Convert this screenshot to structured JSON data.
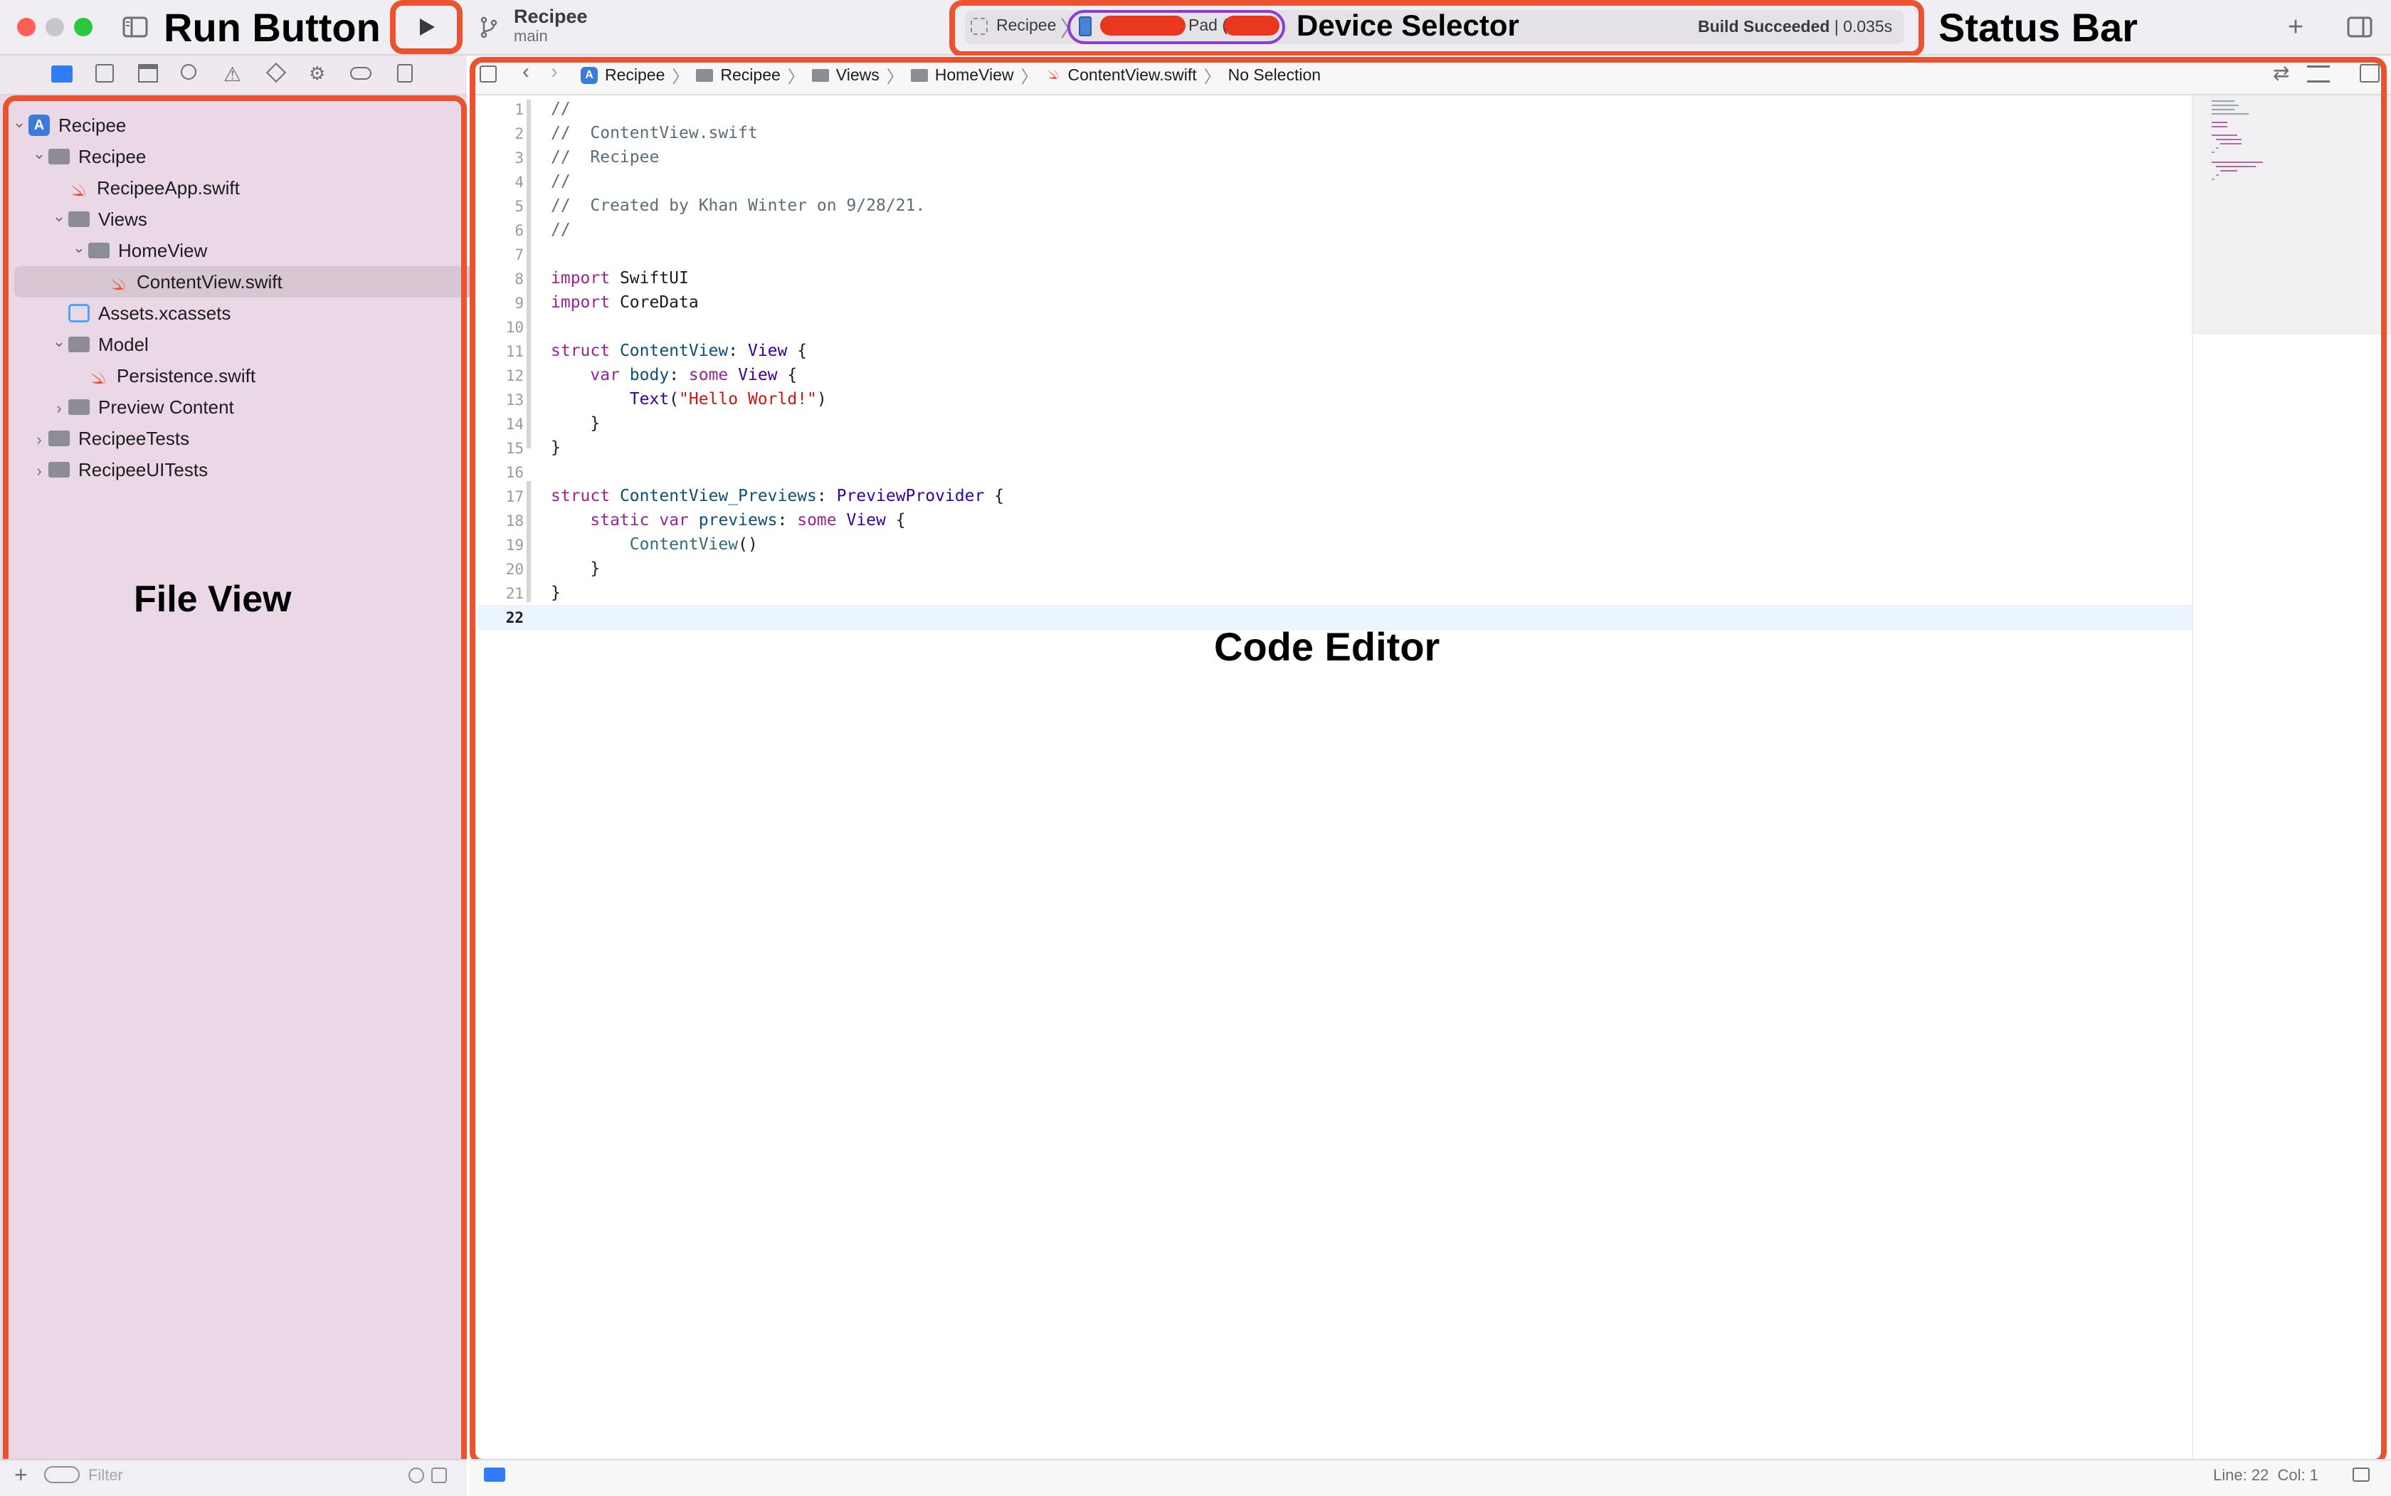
{
  "toolbar": {
    "project": "Recipee",
    "branch": "main",
    "scheme": "Recipee",
    "device_suffix": "Pad (",
    "build_status_bold": "Build Succeeded",
    "build_status_rest": "| 0.035s"
  },
  "annotations": {
    "run_button": "Run Button",
    "device_selector": "Device Selector",
    "status_bar": "Status Bar",
    "file_view": "File View",
    "code_editor": "Code Editor"
  },
  "navigator": {
    "items": [
      {
        "label": "Recipee",
        "kind": "project",
        "depth": 0,
        "disclosure": "open"
      },
      {
        "label": "Recipee",
        "kind": "folder",
        "depth": 1,
        "disclosure": "open"
      },
      {
        "label": "RecipeeApp.swift",
        "kind": "swift",
        "depth": 2,
        "disclosure": "none"
      },
      {
        "label": "Views",
        "kind": "folder",
        "depth": 2,
        "disclosure": "open"
      },
      {
        "label": "HomeView",
        "kind": "folder",
        "depth": 3,
        "disclosure": "open"
      },
      {
        "label": "ContentView.swift",
        "kind": "swift",
        "depth": 4,
        "disclosure": "none",
        "selected": true
      },
      {
        "label": "Assets.xcassets",
        "kind": "assets",
        "depth": 2,
        "disclosure": "none"
      },
      {
        "label": "Model",
        "kind": "folder",
        "depth": 2,
        "disclosure": "open"
      },
      {
        "label": "Persistence.swift",
        "kind": "swift",
        "depth": 3,
        "disclosure": "none"
      },
      {
        "label": "Preview Content",
        "kind": "folder",
        "depth": 2,
        "disclosure": "closed"
      },
      {
        "label": "RecipeeTests",
        "kind": "folder",
        "depth": 1,
        "disclosure": "closed"
      },
      {
        "label": "RecipeeUITests",
        "kind": "folder",
        "depth": 1,
        "disclosure": "closed"
      }
    ],
    "filter_placeholder": "Filter"
  },
  "jumpbar": {
    "crumbs": [
      "Recipee",
      "Recipee",
      "Views",
      "HomeView",
      "ContentView.swift",
      "No Selection"
    ]
  },
  "editor": {
    "line_numbers": [
      "1",
      "2",
      "3",
      "4",
      "5",
      "6",
      "7",
      "8",
      "9",
      "10",
      "11",
      "12",
      "13",
      "14",
      "15",
      "16",
      "17",
      "18",
      "19",
      "20",
      "21",
      "22"
    ],
    "current_line": "22"
  },
  "status": {
    "line": "Line: 22",
    "col": "Col: 1"
  },
  "colors": {
    "annotation_red": "#e9532f",
    "device_pill_border": "#8a3fd1",
    "swift_orange": "#f05138"
  }
}
